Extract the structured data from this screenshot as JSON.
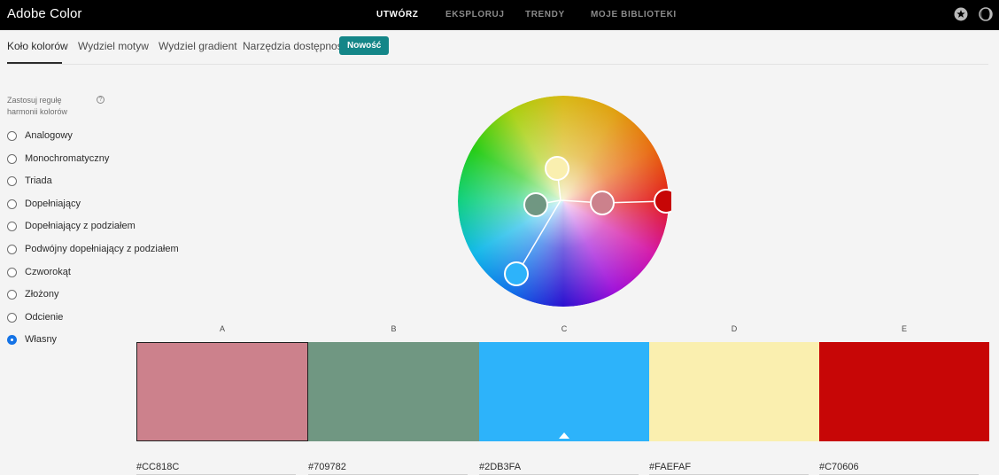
{
  "app": {
    "title": "Adobe Color"
  },
  "topnav": {
    "items": [
      {
        "label": "UTWÓRZ",
        "active": true
      },
      {
        "label": "EKSPLORUJ",
        "active": false
      },
      {
        "label": "TRENDY",
        "active": false
      },
      {
        "label": "MOJE BIBLIOTEKI",
        "active": false
      }
    ],
    "icons": [
      "star-icon",
      "dark-mode-icon"
    ]
  },
  "subtabs": {
    "items": [
      {
        "label": "Koło kolorów",
        "active": true
      },
      {
        "label": "Wydziel motyw",
        "active": false
      },
      {
        "label": "Wydziel gradient",
        "active": false
      },
      {
        "label": "Narzędzia dostępności",
        "active": false
      }
    ],
    "badge": "Nowość"
  },
  "harmony": {
    "label": "Zastosuj regułę harmonii kolorów",
    "help_icon": "question-icon",
    "rules": [
      {
        "label": "Analogowy",
        "checked": false
      },
      {
        "label": "Monochromatyczny",
        "checked": false
      },
      {
        "label": "Triada",
        "checked": false
      },
      {
        "label": "Dopełniający",
        "checked": false
      },
      {
        "label": "Dopełniający z podziałem",
        "checked": false
      },
      {
        "label": "Podwójny dopełniający z podziałem",
        "checked": false
      },
      {
        "label": "Czworokąt",
        "checked": false
      },
      {
        "label": "Złożony",
        "checked": false
      },
      {
        "label": "Odcienie",
        "checked": false
      },
      {
        "label": "Własny",
        "checked": true
      }
    ]
  },
  "swatches": [
    {
      "letter": "A",
      "hex": "#CC818C",
      "color": "#CC818C",
      "selected": false
    },
    {
      "letter": "B",
      "hex": "#709782",
      "color": "#709782",
      "selected": false
    },
    {
      "letter": "C",
      "hex": "#2DB3FA",
      "color": "#2DB3FA",
      "selected": true
    },
    {
      "letter": "D",
      "hex": "#FAEFAF",
      "color": "#FAEFAF",
      "selected": false
    },
    {
      "letter": "E",
      "hex": "#C70606",
      "color": "#C70606",
      "selected": false
    }
  ],
  "colors": {
    "accent": "#1473e6",
    "badge": "#148688",
    "topbar": "#000000"
  }
}
